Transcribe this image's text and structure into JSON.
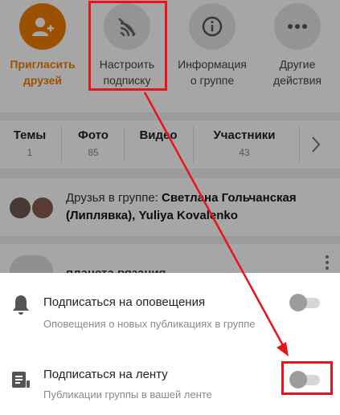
{
  "actions": [
    {
      "label_line1": "Пригласить",
      "label_line2": "друзей",
      "icon": "add-user-icon",
      "active": true
    },
    {
      "label_line1": "Настроить",
      "label_line2": "подписку",
      "icon": "subscription-settings-icon",
      "active": false
    },
    {
      "label_line1": "Информация",
      "label_line2": "о группе",
      "icon": "info-icon",
      "active": false
    },
    {
      "label_line1": "Другие",
      "label_line2": "действия",
      "icon": "more-icon",
      "active": false
    }
  ],
  "tabs": [
    {
      "name": "Темы",
      "count": "1"
    },
    {
      "name": "Фото",
      "count": "85"
    },
    {
      "name": "Видео",
      "count": ""
    },
    {
      "name": "Участники",
      "count": "43"
    }
  ],
  "friends": {
    "prefix": "Друзья в группе: ",
    "names": "Светлана Гольчанская (Липлявка), Yuliya Kovalenko"
  },
  "post": {
    "title": "планета вязания"
  },
  "sheet": {
    "notifications": {
      "title": "Подписаться на оповещения",
      "subtitle": "Оповещения о новых публикациях в группе",
      "icon": "bell-icon",
      "enabled": false
    },
    "feed": {
      "title": "Подписаться на ленту",
      "subtitle": "Публикации группы в вашей ленте",
      "icon": "feed-icon",
      "enabled": false
    }
  },
  "colors": {
    "accent": "#f07d00",
    "annotation": "#e8141b"
  }
}
